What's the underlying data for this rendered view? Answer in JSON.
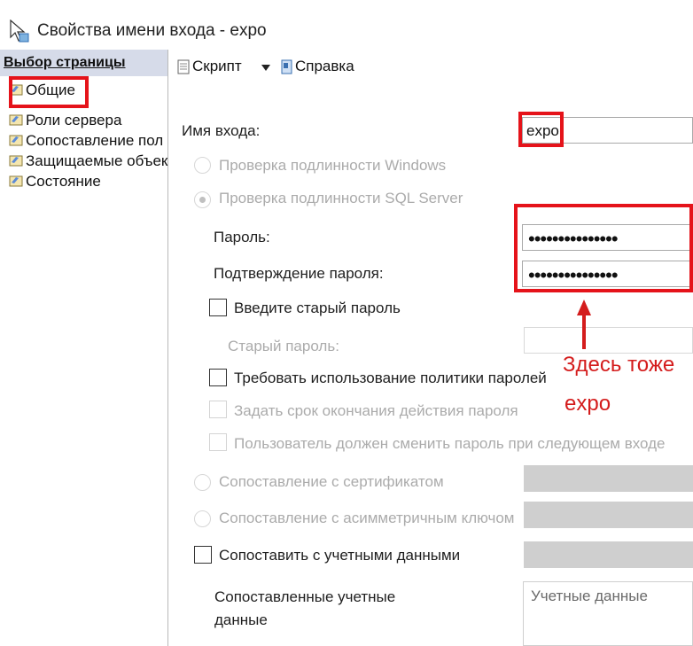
{
  "window": {
    "title": "Свойства имени входа - expo"
  },
  "sidebar": {
    "header": "Выбор страницы",
    "items": [
      {
        "label": "Общие"
      },
      {
        "label": "Роли сервера"
      },
      {
        "label": "Сопоставление пол"
      },
      {
        "label": "Защищаемые объек"
      },
      {
        "label": "Состояние"
      }
    ]
  },
  "toolbar": {
    "script_label": "Скрипт",
    "help_label": "Справка"
  },
  "form": {
    "login_label": "Имя входа:",
    "login_value": "expo",
    "auth_windows": "Проверка подлинности Windows",
    "auth_sql": "Проверка подлинности SQL Server",
    "password_label": "Пароль:",
    "password_value": "•••••••••••••••",
    "confirm_label": "Подтверждение пароля:",
    "confirm_value": "•••••••••••••••",
    "old_password_check": "Введите старый пароль",
    "old_password_label": "Старый пароль:",
    "enforce_policy": "Требовать использование политики паролей",
    "enforce_expiration": "Задать срок окончания действия пароля",
    "must_change": "Пользователь должен сменить пароль при следующем входе",
    "map_certificate": "Сопоставление с сертификатом",
    "map_asym_key": "Сопоставление с асимметричным ключом",
    "map_credentials": "Сопоставить с учетными данными",
    "mapped_credentials_line1": "Сопоставленные учетные",
    "mapped_credentials_line2": "данные",
    "credentials_placeholder": "Учетные данные"
  },
  "annotation": {
    "line1": "Здесь тоже",
    "line2": "expo"
  },
  "colors": {
    "highlight_red": "#e5131a",
    "sidebar_header": "#d6dbe9",
    "disabled_text": "#ababab"
  }
}
